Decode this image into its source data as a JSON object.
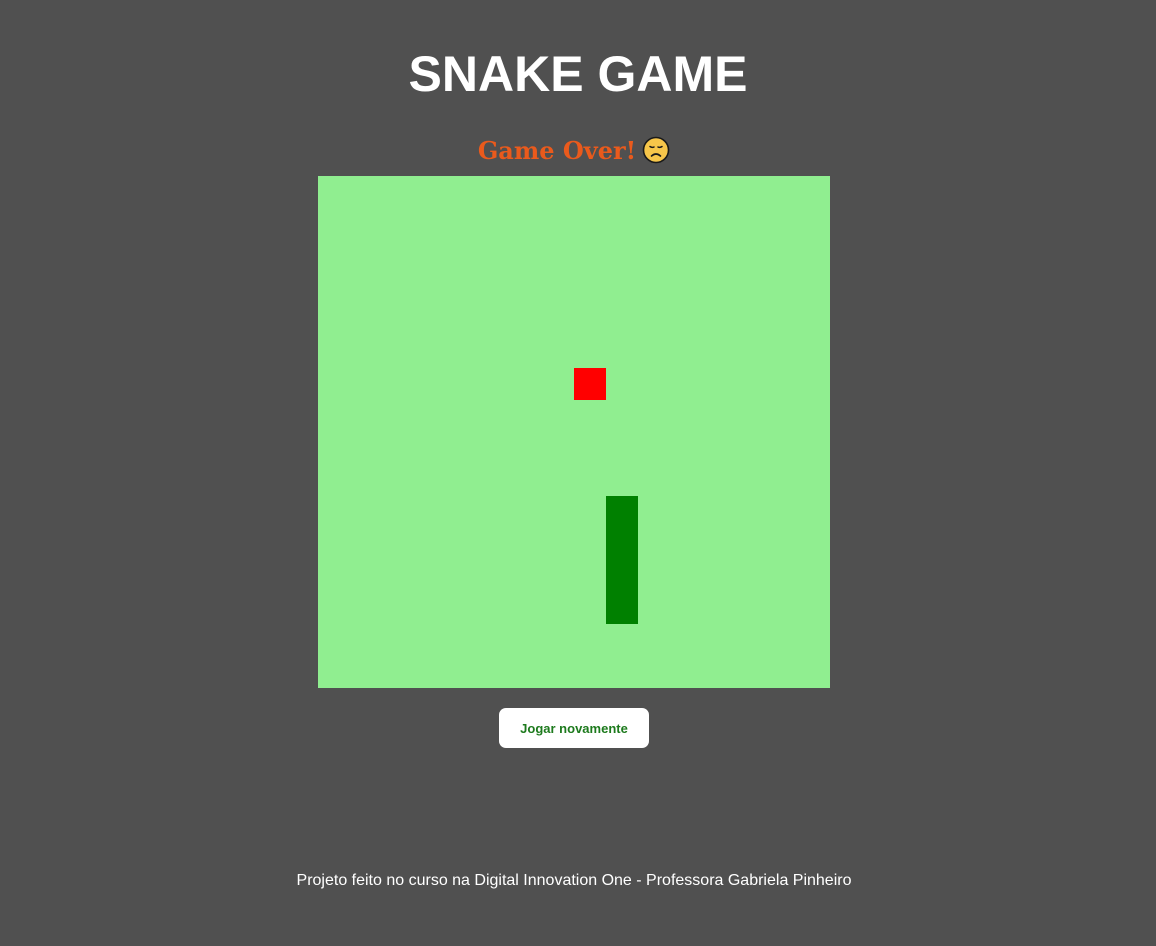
{
  "header": {
    "title": "SNAKE GAME"
  },
  "game": {
    "status_text": "Game Over!",
    "status_icon": "sad-face-icon",
    "grid_columns": 16,
    "grid_rows": 16,
    "food": {
      "col": 8,
      "row": 6
    },
    "snake": [
      {
        "col": 9,
        "row": 10
      },
      {
        "col": 9,
        "row": 11
      },
      {
        "col": 9,
        "row": 12
      },
      {
        "col": 9,
        "row": 13
      }
    ]
  },
  "controls": {
    "replay_label": "Jogar novamente"
  },
  "footer": {
    "credit_text": "Projeto feito no curso na Digital Innovation One - Professora Gabriela Pinheiro"
  },
  "colors": {
    "background": "#505050",
    "board": "#90ee90",
    "snake": "#008000",
    "food": "#ff0000",
    "status": "#ea5a1c",
    "button_text": "#1d7a1d"
  }
}
